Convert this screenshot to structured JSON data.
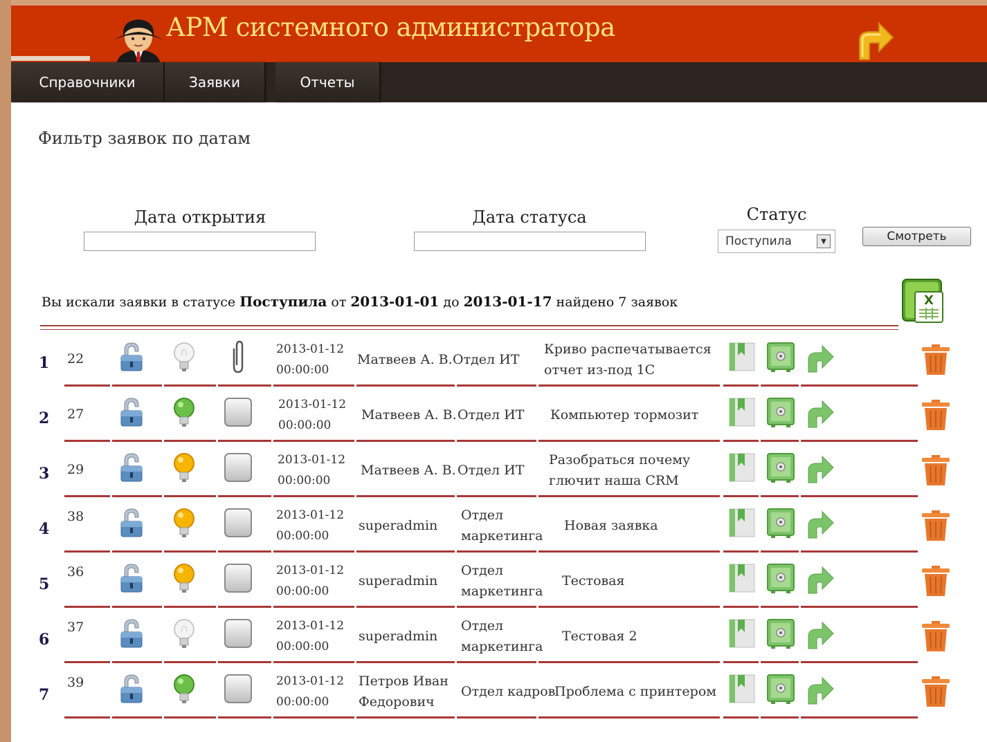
{
  "header": {
    "title": "АРМ системного администратора"
  },
  "nav": {
    "items": [
      "Справочники",
      "Заявки",
      "Отчеты"
    ]
  },
  "filter": {
    "title": "Фильтр заявок по датам",
    "open_date_label": "Дата открытия",
    "open_date_value": "",
    "status_date_label": "Дата статуса",
    "status_date_value": "",
    "status_label": "Статус",
    "status_selected": "Поступила",
    "view_button": "Смотреть"
  },
  "summary": {
    "prefix": "Вы искали заявки в статусе",
    "status": "Поступила",
    "from_word": "от",
    "from": "2013-01-01",
    "to_word": "до",
    "to": "2013-01-17",
    "found_word": "найдено",
    "count": "7",
    "suffix": "заявок"
  },
  "colors": {
    "header_bg": "#cc3300",
    "title_color": "#ffe27a",
    "nav_bg": "#2b2420",
    "row_rule": "#a83838",
    "action_green": "#7cc46a",
    "delete_orange": "#e8772e"
  },
  "rows": [
    {
      "num": "1",
      "id": "22",
      "bulb": "off",
      "attach": "clip",
      "date": "2013-01-12",
      "time": "00:00:00",
      "author": [
        "Матвеев А. В."
      ],
      "dept": [
        "Отдел ИТ"
      ],
      "desc": [
        "Криво распечатывается",
        "отчет из-под 1С"
      ]
    },
    {
      "num": "2",
      "id": "27",
      "bulb": "green",
      "attach": "box",
      "date": "2013-01-12",
      "time": "00:00:00",
      "author": [
        "Матвеев А. В."
      ],
      "dept": [
        "Отдел ИТ"
      ],
      "desc": [
        "Компьютер тормозит"
      ]
    },
    {
      "num": "3",
      "id": "29",
      "bulb": "yellow",
      "attach": "box",
      "date": "2013-01-12",
      "time": "00:00:00",
      "author": [
        "Матвеев А. В."
      ],
      "dept": [
        "Отдел ИТ"
      ],
      "desc": [
        "Разобраться почему",
        "глючит наша CRM"
      ]
    },
    {
      "num": "4",
      "id": "38",
      "bulb": "yellow",
      "attach": "box",
      "date": "2013-01-12",
      "time": "00:00:00",
      "author": [
        "superadmin"
      ],
      "dept": [
        "Отдел",
        "маркетинга"
      ],
      "desc": [
        "Новая заявка"
      ]
    },
    {
      "num": "5",
      "id": "36",
      "bulb": "yellow",
      "attach": "box",
      "date": "2013-01-12",
      "time": "00:00:00",
      "author": [
        "superadmin"
      ],
      "dept": [
        "Отдел",
        "маркетинга"
      ],
      "desc": [
        "Тестовая"
      ]
    },
    {
      "num": "6",
      "id": "37",
      "bulb": "off",
      "attach": "box",
      "date": "2013-01-12",
      "time": "00:00:00",
      "author": [
        "superadmin"
      ],
      "dept": [
        "Отдел",
        "маркетинга"
      ],
      "desc": [
        "Тестовая 2"
      ]
    },
    {
      "num": "7",
      "id": "39",
      "bulb": "green",
      "attach": "box",
      "date": "2013-01-12",
      "time": "00:00:00",
      "author": [
        "Петров Иван",
        "Федорович"
      ],
      "dept": [
        "Отдел кадров"
      ],
      "desc": [
        "Проблема с принтером"
      ]
    }
  ]
}
